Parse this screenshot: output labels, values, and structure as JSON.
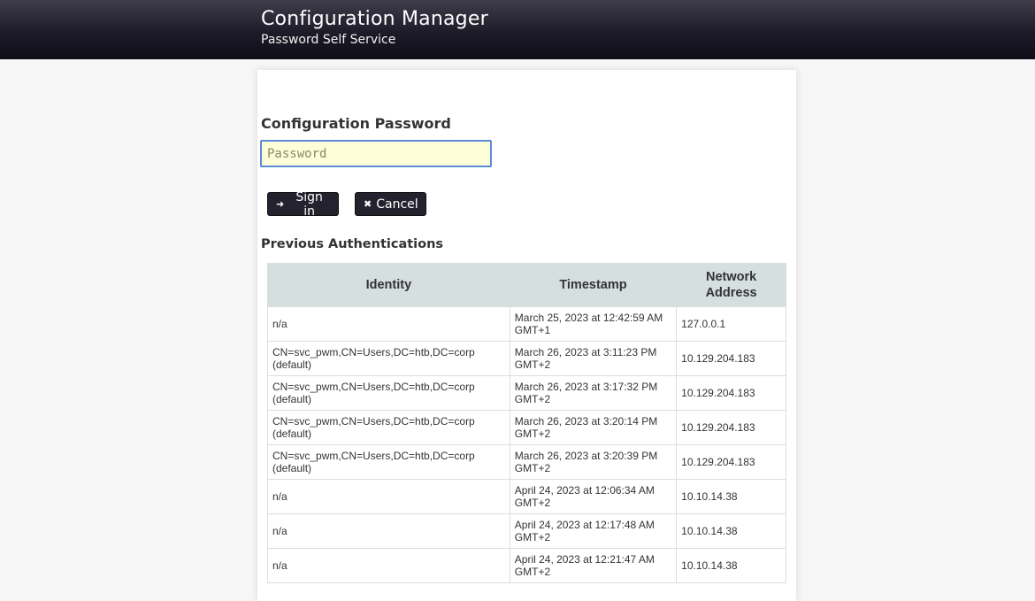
{
  "header": {
    "title": "Configuration Manager",
    "subtitle": "Password Self Service"
  },
  "login": {
    "section_title": "Configuration Password",
    "password_placeholder": "Password",
    "signin_label": "Sign in",
    "cancel_label": "Cancel"
  },
  "auth_table": {
    "title": "Previous Authentications",
    "columns": [
      "Identity",
      "Timestamp",
      "Network\nAddress"
    ],
    "rows": [
      {
        "identity": "n/a",
        "timestamp": "March 25, 2023 at 12:42:59 AM GMT+1",
        "address": "127.0.0.1"
      },
      {
        "identity": "CN=svc_pwm,CN=Users,DC=htb,DC=corp (default)",
        "timestamp": "March 26, 2023 at 3:11:23 PM GMT+2",
        "address": "10.129.204.183"
      },
      {
        "identity": "CN=svc_pwm,CN=Users,DC=htb,DC=corp (default)",
        "timestamp": "March 26, 2023 at 3:17:32 PM GMT+2",
        "address": "10.129.204.183"
      },
      {
        "identity": "CN=svc_pwm,CN=Users,DC=htb,DC=corp (default)",
        "timestamp": "March 26, 2023 at 3:20:14 PM GMT+2",
        "address": "10.129.204.183"
      },
      {
        "identity": "CN=svc_pwm,CN=Users,DC=htb,DC=corp (default)",
        "timestamp": "March 26, 2023 at 3:20:39 PM GMT+2",
        "address": "10.129.204.183"
      },
      {
        "identity": "n/a",
        "timestamp": "April 24, 2023 at 12:06:34 AM GMT+2",
        "address": "10.10.14.38"
      },
      {
        "identity": "n/a",
        "timestamp": "April 24, 2023 at 12:17:48 AM GMT+2",
        "address": "10.10.14.38"
      },
      {
        "identity": "n/a",
        "timestamp": "April 24, 2023 at 12:21:47 AM GMT+2",
        "address": "10.10.14.38"
      }
    ]
  },
  "icons": {
    "signin": "sign-in-icon",
    "cancel": "close-icon"
  },
  "colors": {
    "header_dark": "#1e1b29",
    "button_bg": "#25222f",
    "input_bg": "#fefed8",
    "input_border": "#5b8bd6",
    "table_header_bg": "#d6dfdf"
  }
}
